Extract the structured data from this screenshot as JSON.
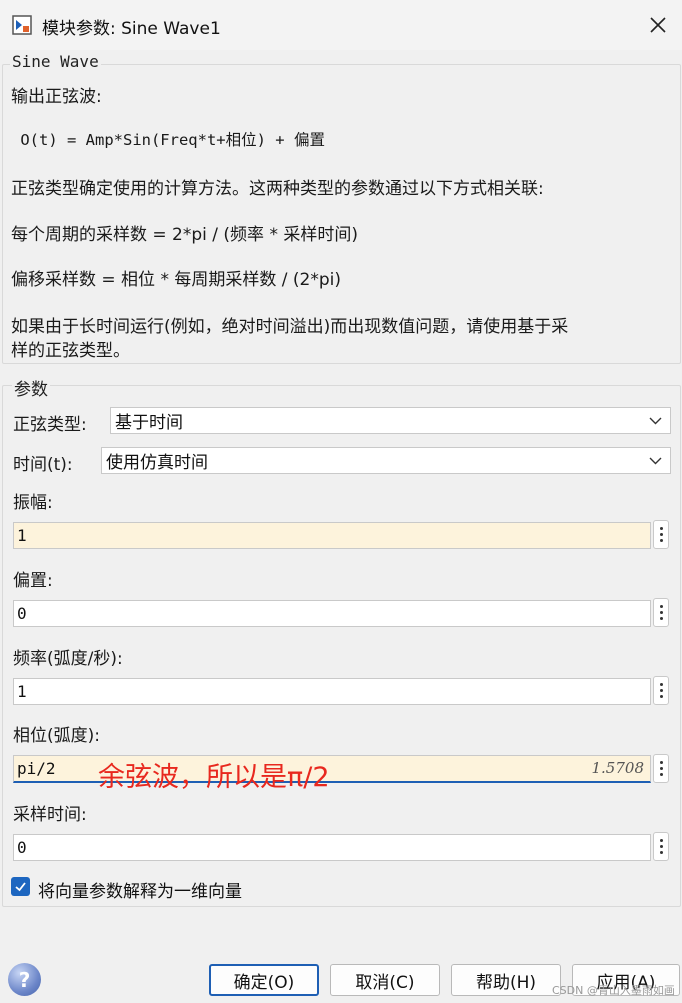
{
  "window": {
    "title": "模块参数: Sine Wave1",
    "close_icon": "close-icon"
  },
  "description": {
    "legend": "Sine Wave",
    "lines": [
      "输出正弦波:",
      " O(t) = Amp*Sin(Freq*t+相位) + 偏置",
      "正弦类型确定使用的计算方法。这两种类型的参数通过以下方式相关联:",
      "每个周期的采样数 = 2*pi / (频率 * 采样时间)",
      "偏移采样数 = 相位 * 每周期采样数 / (2*pi)",
      "如果由于长时间运行(例如，绝对时间溢出)而出现数值问题，请使用基于采",
      "样的正弦类型。"
    ]
  },
  "params": {
    "legend": "参数",
    "sine_type": {
      "label": "正弦类型:",
      "value": "基于时间"
    },
    "time": {
      "label": "时间(t):",
      "value": "使用仿真时间"
    },
    "amplitude": {
      "label": "振幅:",
      "value": "1"
    },
    "bias": {
      "label": "偏置:",
      "value": "0"
    },
    "frequency": {
      "label": "频率(弧度/秒):",
      "value": "1"
    },
    "phase": {
      "label": "相位(弧度):",
      "value": "pi/2",
      "evaluated": "1.5708"
    },
    "sample_time": {
      "label": "采样时间:",
      "value": "0"
    },
    "vector_checkbox": {
      "label": "将向量参数解释为一维向量",
      "checked": true
    }
  },
  "annotation": "余弦波，所以是π/2",
  "buttons": {
    "ok": "确定(O)",
    "cancel": "取消(C)",
    "help": "帮助(H)",
    "apply": "应用(A)"
  },
  "watermark": "CSDN @青山入墨雨如画",
  "colors": {
    "accent": "#1e5fb4",
    "field_highlight": "#fdf3dc",
    "annotation": "#e8281e"
  }
}
